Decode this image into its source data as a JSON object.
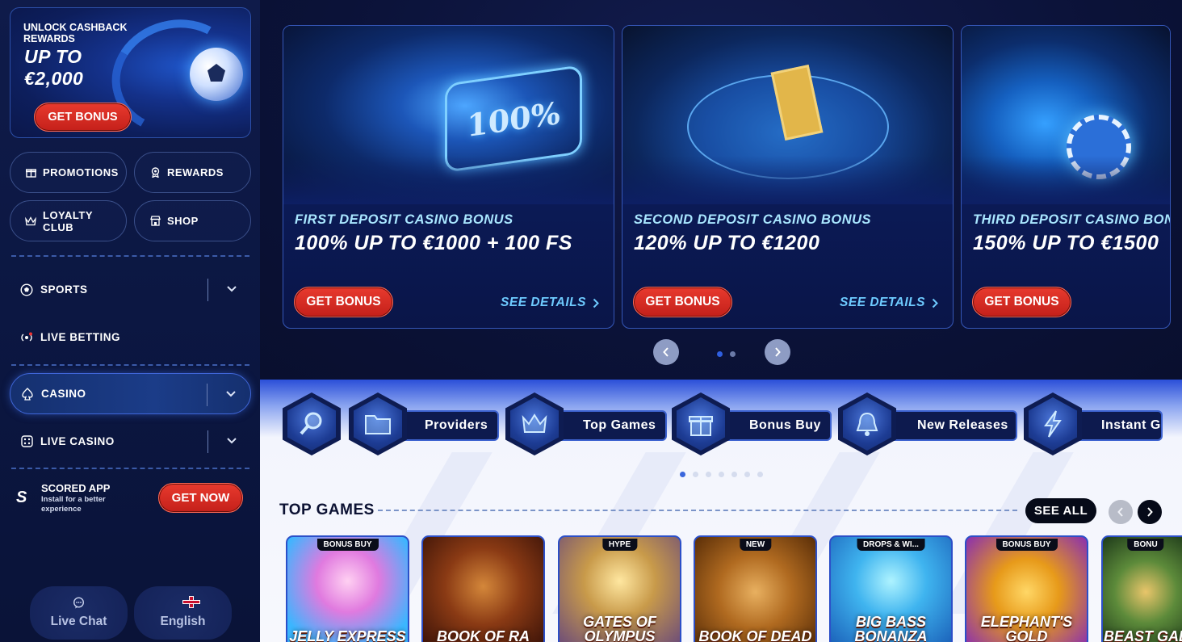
{
  "sidebar": {
    "cashback": {
      "small": "UNLOCK CASHBACK REWARDS",
      "big": "UP TO €2,000",
      "button": "GET BONUS"
    },
    "quick_links": [
      {
        "label": "PROMOTIONS",
        "icon": "gift-icon"
      },
      {
        "label": "REWARDS",
        "icon": "medal-icon"
      },
      {
        "label": "LOYALTY CLUB",
        "icon": "crown-icon"
      },
      {
        "label": "SHOP",
        "icon": "store-icon"
      }
    ],
    "nav": [
      {
        "label": "SPORTS",
        "icon": "soccer-ball-icon"
      },
      {
        "label": "LIVE BETTING",
        "icon": "live-signal-icon"
      },
      {
        "label": "CASINO",
        "icon": "spade-icon"
      },
      {
        "label": "LIVE CASINO",
        "icon": "dice-icon"
      }
    ],
    "app_promo": {
      "title": "SCORED APP",
      "subtitle": "Install for a better experience",
      "button": "GET NOW"
    },
    "footer": {
      "chat_label": "Live Chat",
      "language_label": "English"
    }
  },
  "promos": [
    {
      "label": "FIRST DEPOSIT CASINO BONUS",
      "offer": "100% UP TO €1000 + 100 FS",
      "cta": "GET BONUS",
      "details": "SEE DETAILS",
      "art_text": "100%"
    },
    {
      "label": "SECOND DEPOSIT CASINO BONUS",
      "offer": "120% UP TO €1200",
      "cta": "GET BONUS",
      "details": "SEE DETAILS"
    },
    {
      "label": "THIRD DEPOSIT CASINO BONUS",
      "offer": "150% UP TO €1500",
      "cta": "GET BONUS"
    }
  ],
  "carousel": {
    "active_dot": 1,
    "dot_count": 2
  },
  "categories": [
    {
      "label": "",
      "icon": "search-icon"
    },
    {
      "label": "Providers",
      "icon": "folder-icon"
    },
    {
      "label": "Top Games",
      "icon": "crown-icon"
    },
    {
      "label": "Bonus Buy",
      "icon": "gift-icon"
    },
    {
      "label": "New Releases",
      "icon": "bell-icon"
    },
    {
      "label": "Instant Games",
      "icon": "lightning-icon"
    }
  ],
  "category_dots": {
    "active": 1,
    "count": 7
  },
  "top_games": {
    "title": "TOP GAMES",
    "see_all": "SEE ALL",
    "games": [
      {
        "tag": "BONUS BUY",
        "name": "JELLY EXPRESS"
      },
      {
        "tag": "",
        "name": "BOOK OF RA"
      },
      {
        "tag": "HYPE",
        "name": "GATES OF OLYMPUS"
      },
      {
        "tag": "NEW",
        "name": "BOOK OF DEAD"
      },
      {
        "tag": "DROPS & WI...",
        "name": "BIG BASS BONANZA"
      },
      {
        "tag": "BONUS BUY",
        "name": "ELEPHANT'S GOLD"
      },
      {
        "tag": "BONU",
        "name": "BEAST GAL"
      }
    ]
  },
  "colors": {
    "accent_red": "#d62a22",
    "accent_blue": "#3d63d0",
    "sidebar_bg": "#0f1b4a",
    "highlight_cyan": "#6ecbff"
  }
}
